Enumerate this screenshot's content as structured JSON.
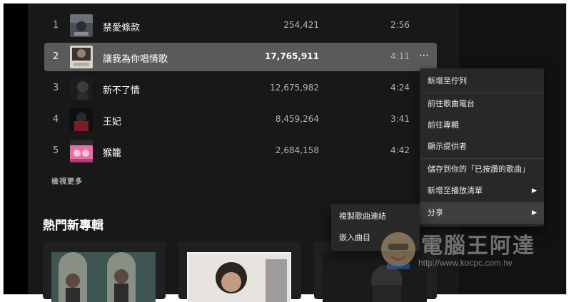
{
  "tracks": [
    {
      "num": "1",
      "title": "禁愛條款",
      "plays": "254,421",
      "duration": "2:56"
    },
    {
      "num": "2",
      "title": "讓我為你唱情歌",
      "plays": "17,765,911",
      "duration": "4:11"
    },
    {
      "num": "3",
      "title": "新不了情",
      "plays": "12,675,982",
      "duration": "4:24"
    },
    {
      "num": "4",
      "title": "王妃",
      "plays": "8,459,264",
      "duration": "3:41"
    },
    {
      "num": "5",
      "title": "猴籠",
      "plays": "2,684,158",
      "duration": "4:42"
    }
  ],
  "more_icon": "⋯",
  "show_more_label": "檢視更多",
  "section_title": "熱門新專輯",
  "context_menu": {
    "items": [
      {
        "label": "新增至佇列"
      },
      {
        "label": "前往歌曲電台"
      },
      {
        "label": "前往專輯"
      },
      {
        "label": "顯示提供者"
      },
      {
        "label": "儲存到你的「已按讚的歌曲」"
      },
      {
        "label": "新增至播放清單"
      },
      {
        "label": "分享"
      }
    ],
    "arrow": "▶"
  },
  "share_submenu": {
    "items": [
      {
        "label": "複製歌曲連結"
      },
      {
        "label": "嵌入曲目"
      }
    ]
  },
  "watermark": {
    "text": "電腦王阿達",
    "url": "http://www.kocpc.com.tw"
  },
  "colors": {
    "background": "#121212",
    "panel": "#181818",
    "highlight_row": "#5a5a5a",
    "menu": "#282828",
    "text_primary": "#ffffff",
    "text_secondary": "#b3b3b3"
  }
}
